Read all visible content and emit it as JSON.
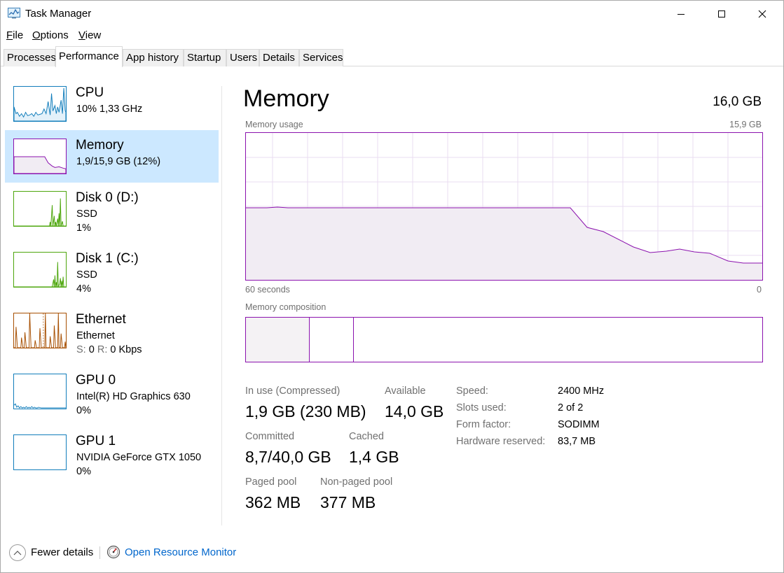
{
  "window": {
    "title": "Task Manager"
  },
  "menu": {
    "file": "File",
    "options": "Options",
    "view": "View"
  },
  "tabs": [
    "Processes",
    "Performance",
    "App history",
    "Startup",
    "Users",
    "Details",
    "Services"
  ],
  "sidebar": {
    "items": [
      {
        "title": "CPU",
        "line1": "10%  1,33 GHz",
        "line2": "",
        "color": "#117dbb"
      },
      {
        "title": "Memory",
        "line1": "1,9/15,9 GB (12%)",
        "line2": "",
        "color": "#8b12ae",
        "selected": true
      },
      {
        "title": "Disk 0 (D:)",
        "line1": "SSD",
        "line2": "1%",
        "color": "#4da60c"
      },
      {
        "title": "Disk 1 (C:)",
        "line1": "SSD",
        "line2": "4%",
        "color": "#4da60c"
      },
      {
        "title": "Ethernet",
        "line1": "Ethernet",
        "line2_s_label": "S:",
        "line2_s_value": "0",
        "line2_r_label": "R:",
        "line2_r_value": "0 Kbps",
        "color": "#a74f01"
      },
      {
        "title": "GPU 0",
        "line1": "Intel(R) HD Graphics 630",
        "line2": "0%",
        "color": "#117dbb"
      },
      {
        "title": "GPU 1",
        "line1": "NVIDIA GeForce GTX 1050",
        "line2": "0%",
        "color": "#117dbb"
      }
    ]
  },
  "main": {
    "title": "Memory",
    "total": "16,0 GB",
    "usage_label": "Memory usage",
    "usage_max": "15,9 GB",
    "time_left": "60 seconds",
    "time_right": "0",
    "composition_label": "Memory composition",
    "stats": {
      "in_use_label": "In use (Compressed)",
      "in_use_value": "1,9 GB (230 MB)",
      "available_label": "Available",
      "available_value": "14,0 GB",
      "committed_label": "Committed",
      "committed_value": "8,7/40,0 GB",
      "cached_label": "Cached",
      "cached_value": "1,4 GB",
      "paged_label": "Paged pool",
      "paged_value": "362 MB",
      "nonpaged_label": "Non-paged pool",
      "nonpaged_value": "377 MB"
    },
    "details": [
      {
        "label": "Speed:",
        "value": "2400 MHz"
      },
      {
        "label": "Slots used:",
        "value": "2 of 2"
      },
      {
        "label": "Form factor:",
        "value": "SODIMM"
      },
      {
        "label": "Hardware reserved:",
        "value": "83,7 MB"
      }
    ]
  },
  "footer": {
    "fewer_details": "Fewer details",
    "open_resource_monitor": "Open Resource Monitor"
  },
  "colors": {
    "memory": "#8b12ae",
    "cpu": "#117dbb",
    "disk": "#4da60c",
    "ethernet": "#a74f01",
    "selected_bg": "#cce8ff",
    "link": "#0066cc"
  },
  "icons": [
    "task-manager-icon",
    "minimize-icon",
    "maximize-icon",
    "close-icon",
    "chevron-up-icon",
    "resource-monitor-icon"
  ]
}
